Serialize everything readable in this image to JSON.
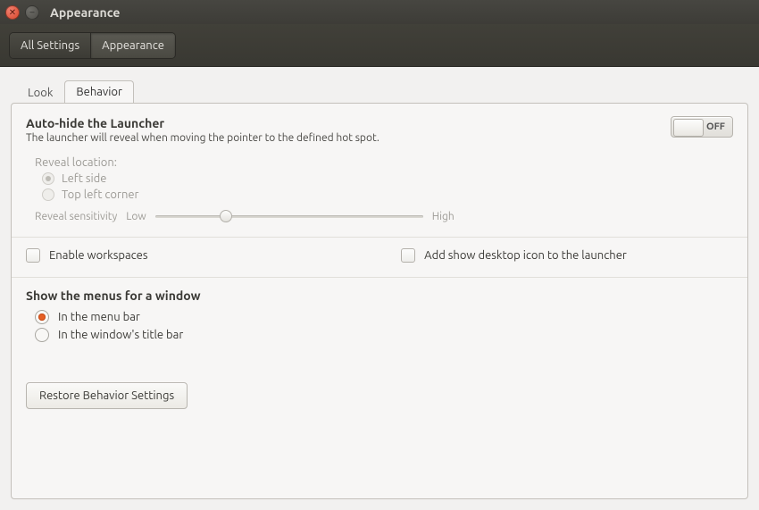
{
  "window": {
    "title": "Appearance"
  },
  "breadcrumb": {
    "all": "All Settings",
    "current": "Appearance"
  },
  "tabs": {
    "look": "Look",
    "behavior": "Behavior",
    "active": "behavior"
  },
  "autohide": {
    "title": "Auto-hide the Launcher",
    "desc": "The launcher will reveal when moving the pointer to the defined hot spot.",
    "switch_label": "OFF",
    "switch_state": "off",
    "reveal_label": "Reveal location:",
    "opt_left": "Left side",
    "opt_topleft": "Top left corner",
    "selected": "left",
    "disabled": true,
    "sensitivity_label": "Reveal sensitivity",
    "low": "Low",
    "high": "High"
  },
  "checks": {
    "workspaces": "Enable workspaces",
    "show_desktop": "Add show desktop icon to the launcher",
    "workspaces_checked": false,
    "show_desktop_checked": false
  },
  "menus": {
    "title": "Show the menus for a window",
    "opt_menubar": "In the menu bar",
    "opt_titlebar": "In the window's title bar",
    "selected": "menubar"
  },
  "restore": {
    "label": "Restore Behavior Settings"
  }
}
